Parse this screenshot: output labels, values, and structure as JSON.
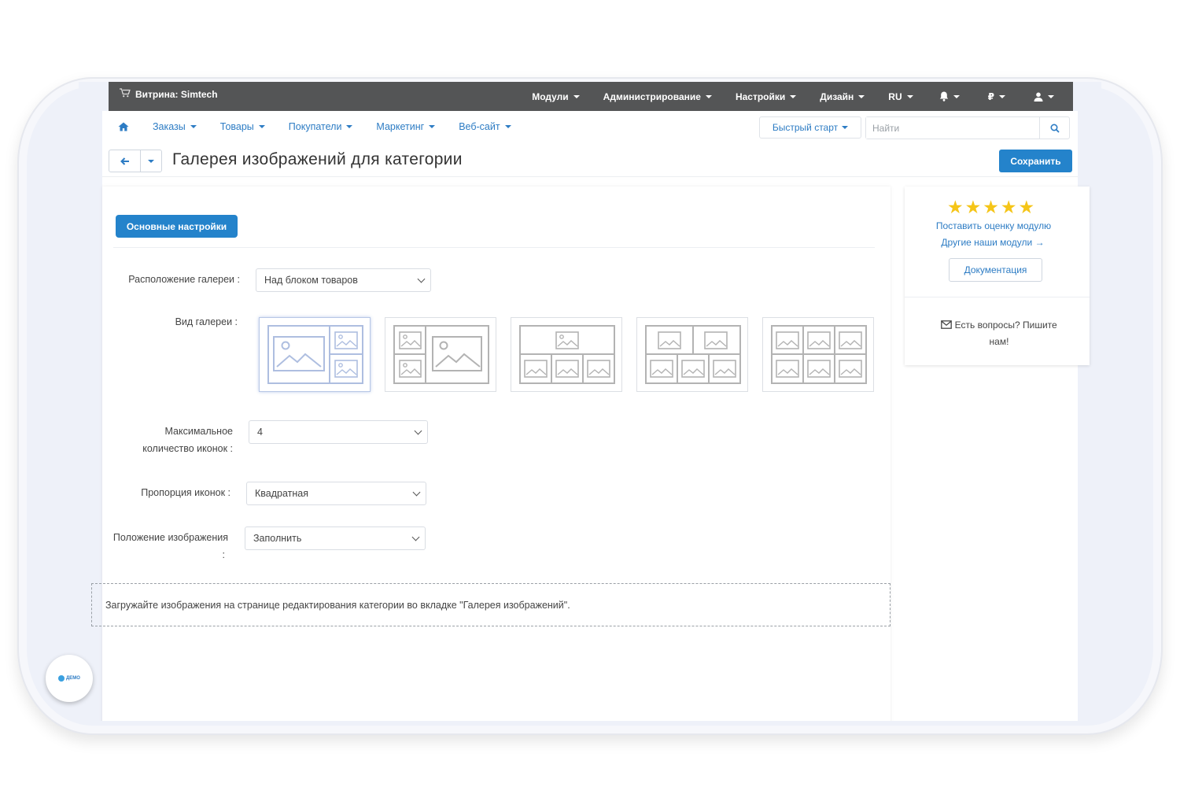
{
  "header": {
    "store_label": "Витрина: Simtech",
    "menu": [
      {
        "label": "Модули"
      },
      {
        "label": "Администрирование"
      },
      {
        "label": "Настройки"
      },
      {
        "label": "Дизайн"
      },
      {
        "label": "RU"
      },
      {
        "label": ""
      },
      {
        "label": "₽"
      },
      {
        "label": ""
      }
    ]
  },
  "subnav": {
    "items": [
      "Заказы",
      "Товары",
      "Покупатели",
      "Маркетинг",
      "Веб-сайт"
    ],
    "quick_start": "Быстрый старт",
    "search_placeholder": "Найти"
  },
  "page": {
    "title": "Галерея изображений для категории",
    "save_label": "Сохранить"
  },
  "settings": {
    "tab_label": "Основные настройки",
    "gallery_position_label": "Расположение галереи :",
    "gallery_position_value": "Над блоком товаров",
    "gallery_type_label": "Вид галереи :",
    "max_icons_label_1": "Максимальное",
    "max_icons_label_2": "количество иконок :",
    "max_icons_value": "4",
    "proportion_label": "Пропорция иконок :",
    "proportion_value": "Квадратная",
    "image_position_label_1": "Положение изображения",
    "image_position_label_2": ":",
    "image_position_value": "Заполнить",
    "note": "Загружайте изображения на странице редактирования категории во вкладке \"Галерея изображений\"."
  },
  "sidebar": {
    "rate_link": "Поставить оценку модулю",
    "other_link": "Другие наши модули →",
    "doc_button": "Документация",
    "contact_1": "Есть вопросы? Пишите",
    "contact_2": "нам!"
  },
  "badge": {
    "label": "ДЕМО"
  },
  "colors": {
    "accent": "#2483cb",
    "topbar": "#545556",
    "link": "#2d7cc4"
  }
}
